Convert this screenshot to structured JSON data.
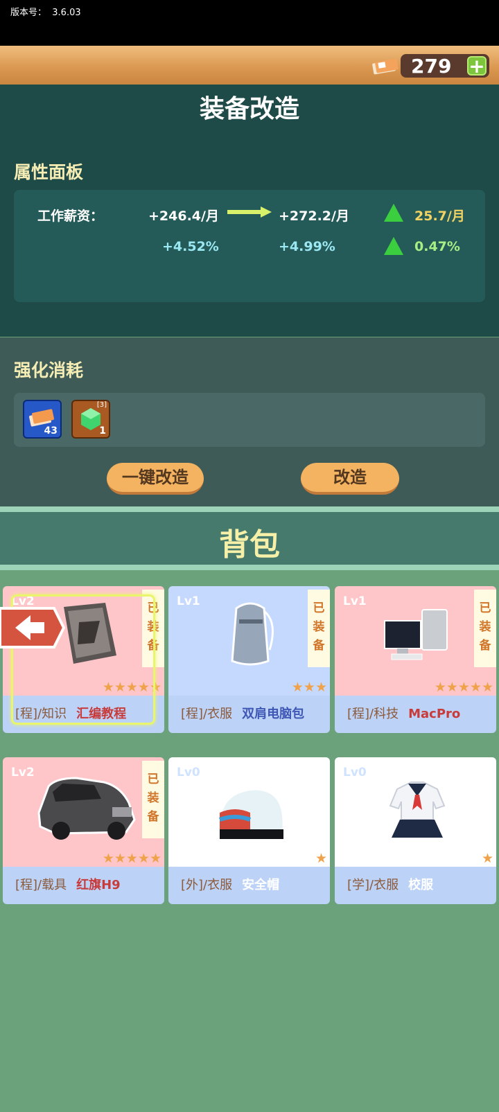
{
  "version": {
    "label": "版本号：",
    "value": "3.6.03"
  },
  "currency": {
    "amount": "279",
    "plus": "+"
  },
  "title": "装备改造",
  "attributes": {
    "section_title": "属性面板",
    "rows": [
      {
        "label": "工作薪资：",
        "current": "+246.4/月",
        "next": "+272.2/月",
        "delta": "25.7/月"
      },
      {
        "label": "",
        "current": "+4.52%",
        "next": "+4.99%",
        "delta": "0.47%"
      }
    ]
  },
  "cost": {
    "section_title": "强化消耗",
    "items": [
      {
        "icon": "cash-ticket-icon",
        "count": "43"
      },
      {
        "icon": "green-gem-icon",
        "count": "1",
        "badge": "[3]"
      }
    ]
  },
  "buttons": {
    "one_click": "一键改造",
    "upgrade": "改造"
  },
  "bag": {
    "title": "背包",
    "items": [
      {
        "level": "Lv2",
        "equipped": [
          "已",
          "装",
          "备"
        ],
        "stars": "★★★★★",
        "category": "[程]/知识",
        "name": "汇编教程",
        "icon": "book-icon",
        "bg": "pink"
      },
      {
        "level": "Lv1",
        "equipped": [
          "已",
          "装",
          "备"
        ],
        "stars": "★★★",
        "category": "[程]/衣服",
        "name": "双肩电脑包",
        "icon": "backpack-icon",
        "bg": "blue"
      },
      {
        "level": "Lv1",
        "equipped": [
          "已",
          "装",
          "备"
        ],
        "stars": "★★★★★",
        "category": "[程]/科技",
        "name": "MacPro",
        "icon": "computer-icon",
        "bg": "pink"
      },
      {
        "level": "Lv2",
        "equipped": [
          "已",
          "装",
          "备"
        ],
        "stars": "★★★★★",
        "category": "[程]/载具",
        "name": "红旗H9",
        "icon": "car-icon",
        "bg": "pink"
      },
      {
        "level": "Lv0",
        "stars": "★",
        "category": "[外]/衣服",
        "name": "安全帽",
        "icon": "helmet-icon",
        "bg": "white"
      },
      {
        "level": "Lv0",
        "stars": "★",
        "category": "[学]/衣服",
        "name": "校服",
        "icon": "uniform-icon",
        "bg": "white"
      }
    ]
  }
}
